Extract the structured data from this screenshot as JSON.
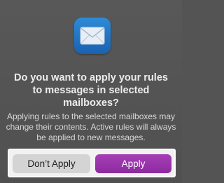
{
  "dialog": {
    "app_icon": "mail-icon",
    "title": "Do you want to apply your rules to messages in selected mailboxes?",
    "message": "Applying rules to the selected mailboxes may change their contents. Active rules will always be applied to new messages.",
    "buttons": {
      "cancel_label": "Don’t Apply",
      "confirm_label": "Apply"
    }
  },
  "colors": {
    "accent": "#9b35ad",
    "dialog_background": "#555555"
  }
}
